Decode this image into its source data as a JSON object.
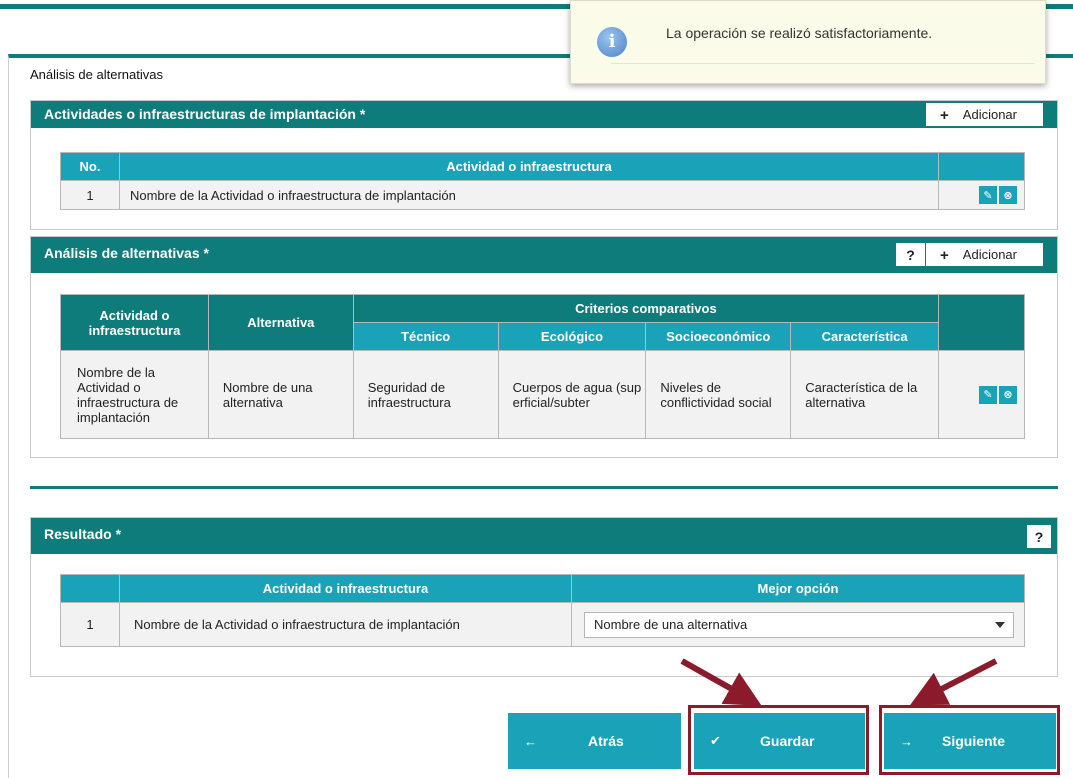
{
  "notification": {
    "message": "La operación se realizó satisfactoriamente."
  },
  "page": {
    "title": "Análisis de alternativas"
  },
  "actividades": {
    "header": "Actividades o infraestructuras de implantación *",
    "add_label": "Adicionar",
    "columns": [
      "No.",
      "Actividad o infraestructura"
    ],
    "rows": [
      {
        "no": "1",
        "name": "Nombre de la Actividad o infraestructura de implantación"
      }
    ]
  },
  "analisis": {
    "header": "Análisis de alternativas *",
    "help_label": "?",
    "add_label": "Adicionar",
    "col_actividad": "Actividad o infraestructura",
    "col_alternativa": "Alternativa",
    "col_criterios": "Criterios comparativos",
    "col_tecnico": "Técnico",
    "col_ecologico": "Ecológico",
    "col_socio": "Socioeconómico",
    "col_caracteristica": "Característica",
    "rows": [
      {
        "actividad": "Nombre de la Actividad o infraestructura de implantación",
        "alternativa": "Nombre de una alternativa",
        "tecnico": "Seguridad de infraestructura",
        "ecologico": "Cuerpos de agua (superficial/subter",
        "socio": "Niveles de conflictividad social",
        "caracteristica": "Característica de la alternativa"
      }
    ]
  },
  "resultado": {
    "header": "Resultado *",
    "help_label": "?",
    "col_actividad": "Actividad o infraestructura",
    "col_mejor": "Mejor opción",
    "rows": [
      {
        "no": "1",
        "name": "Nombre de la Actividad o infraestructura de implantación",
        "selected": "Nombre de una alternativa"
      }
    ]
  },
  "nav": {
    "back": "Atrás",
    "save": "Guardar",
    "next": "Siguiente"
  },
  "colors": {
    "teal_dark": "#0e7c7b",
    "teal_light": "#1aa3b8",
    "highlight": "#8b1a2a"
  },
  "icons": {
    "edit": "pencil-icon",
    "delete": "close-circle-icon",
    "info": "info-icon",
    "add": "plus-icon"
  }
}
